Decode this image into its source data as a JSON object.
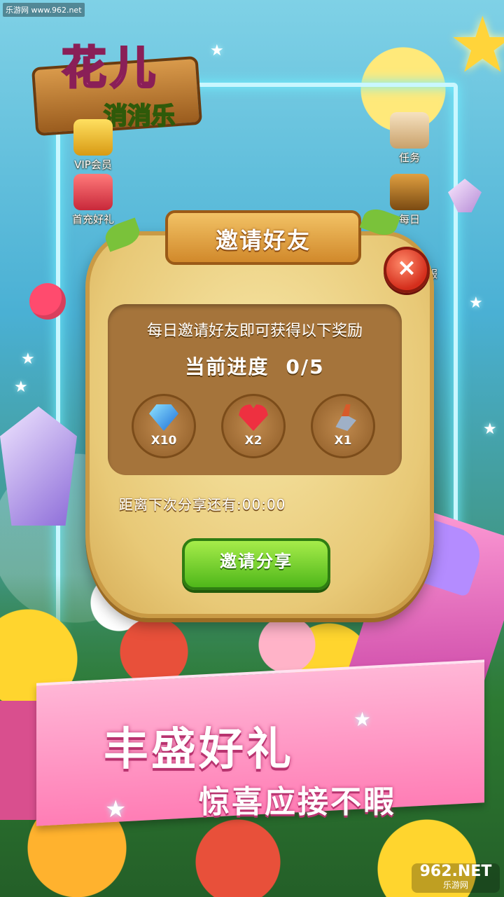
{
  "watermark_top": "乐游网 www.962.net",
  "logo": {
    "line1": "花儿",
    "line2": "消消乐"
  },
  "side_menu": {
    "vip": "VIP会员",
    "first_recharge": "首充好礼",
    "task": "任务",
    "daily": "每日",
    "partial_right": "客服"
  },
  "dialog": {
    "title": "邀请好友",
    "close_label": "×",
    "description": "每日邀请好友即可获得以下奖励",
    "progress_label": "当前进度",
    "progress_value": "0/5",
    "rewards": [
      {
        "icon": "diamond-icon",
        "count": "X10"
      },
      {
        "icon": "heart-icon",
        "count": "X2"
      },
      {
        "icon": "shovel-icon",
        "count": "X1"
      }
    ],
    "timer_label": "距离下次分享还有:",
    "timer_value": "00:00",
    "share_button": "邀请分享"
  },
  "promo": {
    "main": "丰盛好礼",
    "sub": "惊喜应接不暇"
  },
  "watermark_bottom": {
    "brand": "962.NET",
    "name": "乐游网"
  },
  "colors": {
    "frame_glow": "#6ff0ff",
    "dialog_border": "#c99a45",
    "panel": "#a5743b",
    "share_button": "#4fb71a",
    "close_button": "#d42e1c",
    "banner": "#ff7db5"
  }
}
